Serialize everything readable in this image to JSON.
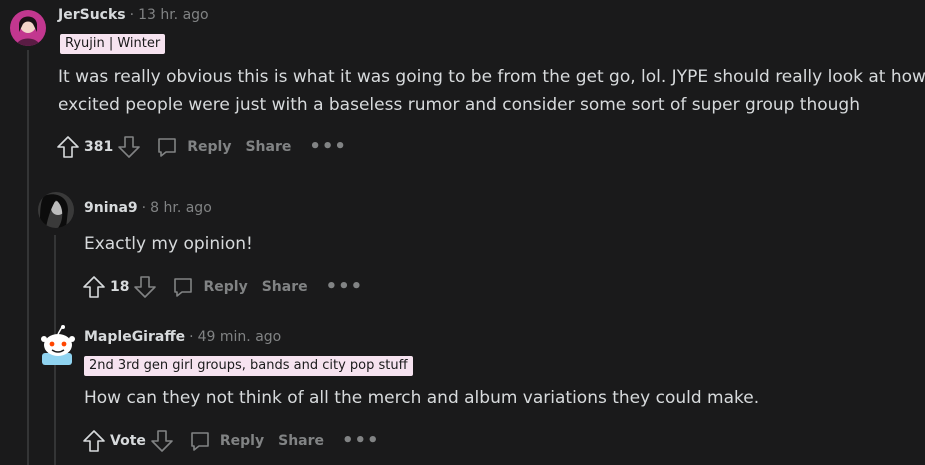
{
  "comments": [
    {
      "username": "JerSucks",
      "time": "13 hr. ago",
      "flair": "Ryujin | Winter",
      "body_lines": [
        "It was really obvious this is what it was going to be from the get go, lol. JYPE should really look at how",
        "excited people were just with a baseless rumor and consider some sort of super group though"
      ],
      "votes": "381",
      "reply_label": "Reply",
      "share_label": "Share",
      "more_label": "•••"
    },
    {
      "username": "9nina9",
      "time": "8 hr. ago",
      "body_lines": [
        "Exactly my opinion!"
      ],
      "votes": "18",
      "reply_label": "Reply",
      "share_label": "Share",
      "more_label": "•••"
    },
    {
      "username": "MapleGiraffe",
      "time": "49 min. ago",
      "flair": "2nd 3rd gen girl groups, bands and city pop  stuff",
      "body_lines": [
        "How can they not think of all the merch and album variations they could make."
      ],
      "votes": "Vote",
      "reply_label": "Reply",
      "share_label": "Share",
      "more_label": "•••"
    }
  ],
  "separator": "·"
}
